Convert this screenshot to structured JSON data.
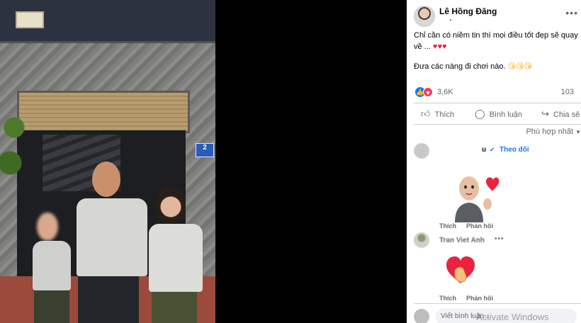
{
  "post": {
    "author": "Lê Hồng Đăng",
    "privacy_icon": "globe-icon",
    "menu_icon": "more-horizontal-icon",
    "text_line1": "Chỉ cần có niềm tin thì mọi điều tốt đẹp sẽ quay",
    "text_line2": "về ...",
    "text_line2_emoji": "♥♥♥",
    "text_line3": "Đưa các nàng đi chơi nào.",
    "text_line3_emoji": "😘😘😘",
    "photo_sign": "2"
  },
  "reactions": {
    "count": "3,6K",
    "comments": "103"
  },
  "actions": {
    "like": "Thích",
    "comment": "Bình luận",
    "share": "Chia sẻ"
  },
  "sort": {
    "label": "Phù hợp nhất"
  },
  "comments": [
    {
      "name": "u",
      "follow": "Theo dõi",
      "sticker": "bald-man-heart-sticker",
      "like": "Thích",
      "reply": "Phản hồi"
    },
    {
      "name": "Tran Viet Anh",
      "sticker": "heart-hand-sticker",
      "like": "Thích",
      "reply": "Phản hồi"
    }
  ],
  "compose": {
    "placeholder": "Viết bình luận..."
  },
  "watermark": "Activate Windows",
  "colors": {
    "accent": "#1877f2",
    "love": "#f33e58",
    "text": "#050505",
    "muted": "#65676b"
  }
}
